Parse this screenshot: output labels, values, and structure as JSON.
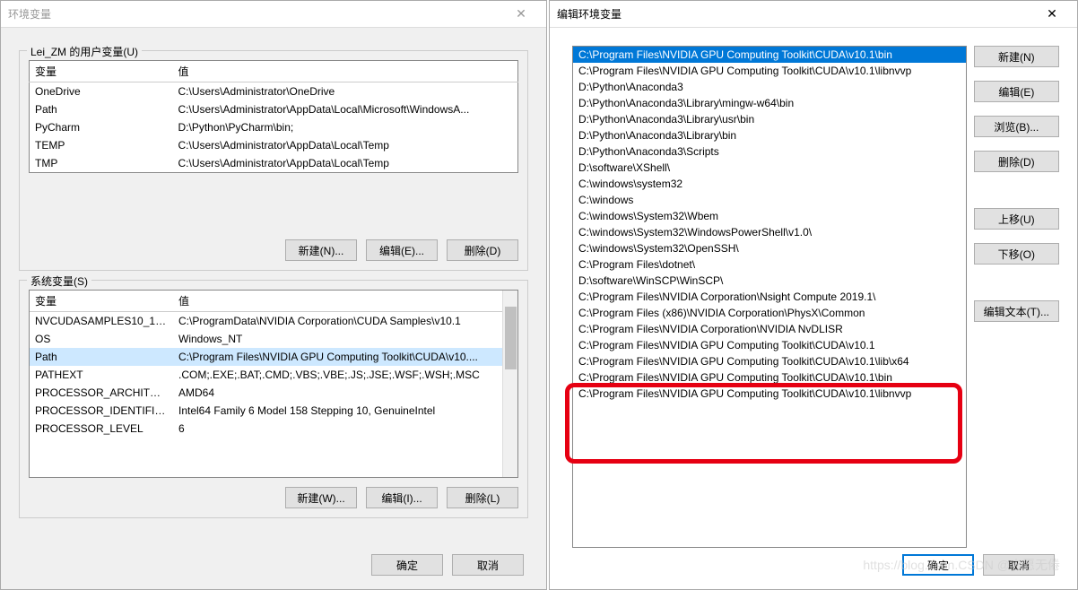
{
  "left_dialog": {
    "title": "环境变量",
    "user_group_label": "Lei_ZM 的用户变量(U)",
    "system_group_label": "系统变量(S)",
    "headers": {
      "var": "变量",
      "val": "值"
    },
    "user_vars": [
      {
        "name": "OneDrive",
        "value": "C:\\Users\\Administrator\\OneDrive"
      },
      {
        "name": "Path",
        "value": "C:\\Users\\Administrator\\AppData\\Local\\Microsoft\\WindowsA..."
      },
      {
        "name": "PyCharm",
        "value": "D:\\Python\\PyCharm\\bin;"
      },
      {
        "name": "TEMP",
        "value": "C:\\Users\\Administrator\\AppData\\Local\\Temp"
      },
      {
        "name": "TMP",
        "value": "C:\\Users\\Administrator\\AppData\\Local\\Temp"
      }
    ],
    "system_vars": [
      {
        "name": "NVCUDASAMPLES10_1_R...",
        "value": "C:\\ProgramData\\NVIDIA Corporation\\CUDA Samples\\v10.1"
      },
      {
        "name": "OS",
        "value": "Windows_NT"
      },
      {
        "name": "Path",
        "value": "C:\\Program Files\\NVIDIA GPU Computing Toolkit\\CUDA\\v10...."
      },
      {
        "name": "PATHEXT",
        "value": ".COM;.EXE;.BAT;.CMD;.VBS;.VBE;.JS;.JSE;.WSF;.WSH;.MSC"
      },
      {
        "name": "PROCESSOR_ARCHITECT...",
        "value": "AMD64"
      },
      {
        "name": "PROCESSOR_IDENTIFIER",
        "value": "Intel64 Family 6 Model 158 Stepping 10, GenuineIntel"
      },
      {
        "name": "PROCESSOR_LEVEL",
        "value": "6"
      }
    ],
    "user_buttons": {
      "new": "新建(N)...",
      "edit": "编辑(E)...",
      "del": "删除(D)"
    },
    "sys_buttons": {
      "new": "新建(W)...",
      "edit": "编辑(I)...",
      "del": "删除(L)"
    },
    "bottom": {
      "ok": "确定",
      "cancel": "取消"
    }
  },
  "right_dialog": {
    "title": "编辑环境变量",
    "paths": [
      "C:\\Program Files\\NVIDIA GPU Computing Toolkit\\CUDA\\v10.1\\bin",
      "C:\\Program Files\\NVIDIA GPU Computing Toolkit\\CUDA\\v10.1\\libnvvp",
      "D:\\Python\\Anaconda3",
      "D:\\Python\\Anaconda3\\Library\\mingw-w64\\bin",
      "D:\\Python\\Anaconda3\\Library\\usr\\bin",
      "D:\\Python\\Anaconda3\\Library\\bin",
      "D:\\Python\\Anaconda3\\Scripts",
      "D:\\software\\XShell\\",
      "C:\\windows\\system32",
      "C:\\windows",
      "C:\\windows\\System32\\Wbem",
      "C:\\windows\\System32\\WindowsPowerShell\\v1.0\\",
      "C:\\windows\\System32\\OpenSSH\\",
      "C:\\Program Files\\dotnet\\",
      "D:\\software\\WinSCP\\WinSCP\\",
      "C:\\Program Files\\NVIDIA Corporation\\Nsight Compute 2019.1\\",
      "C:\\Program Files (x86)\\NVIDIA Corporation\\PhysX\\Common",
      "C:\\Program Files\\NVIDIA Corporation\\NVIDIA NvDLISR",
      "C:\\Program Files\\NVIDIA GPU Computing Toolkit\\CUDA\\v10.1",
      "C:\\Program Files\\NVIDIA GPU Computing Toolkit\\CUDA\\v10.1\\lib\\x64",
      "C:\\Program Files\\NVIDIA GPU Computing Toolkit\\CUDA\\v10.1\\bin",
      "C:\\Program Files\\NVIDIA GPU Computing Toolkit\\CUDA\\v10.1\\libnvvp"
    ],
    "selected_index": 0,
    "buttons": {
      "new": "新建(N)",
      "edit": "编辑(E)",
      "browse": "浏览(B)...",
      "del": "删除(D)",
      "up": "上移(U)",
      "down": "下移(O)",
      "edit_text": "编辑文本(T)..."
    },
    "bottom": {
      "ok": "确定",
      "cancel": "取消"
    }
  },
  "watermark": "https://blog.csdn.CSDN @志愿无倦"
}
